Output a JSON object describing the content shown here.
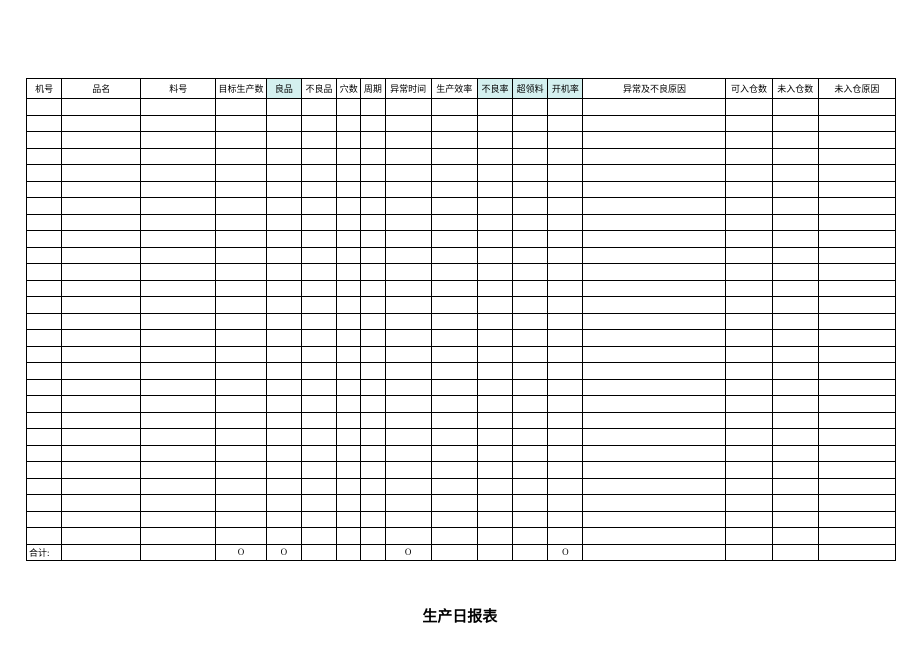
{
  "headers": {
    "machine_no": "机号",
    "product_name": "品名",
    "material_no": "料号",
    "target_qty": "目标生产数",
    "good": "良品",
    "defect": "不良品",
    "cavity": "穴数",
    "cycle": "周期",
    "abnormal_time": "异常时间",
    "efficiency": "生产效率",
    "defect_rate": "不良率",
    "over_material": "超领料",
    "open_rate": "开机率",
    "abnormal_reason": "异常及不良原因",
    "can_stock": "可入仓数",
    "not_stock": "未入仓数",
    "not_stock_reason": "未入仓原因"
  },
  "totals": {
    "label": "合计:",
    "target_qty": "O",
    "good": "O",
    "abnormal_time": "O",
    "open_rate": "O"
  },
  "empty_rows": 27,
  "title": "生产日报表",
  "chart_data": {
    "type": "table",
    "title": "生产日报表",
    "columns": [
      "机号",
      "品名",
      "料号",
      "目标生产数",
      "良品",
      "不良品",
      "穴数",
      "周期",
      "异常时间",
      "生产效率",
      "不良率",
      "超领料",
      "开机率",
      "异常及不良原因",
      "可入仓数",
      "未入仓数",
      "未入仓原因"
    ],
    "highlighted_columns": [
      "良品",
      "不良率",
      "超领料",
      "开机率"
    ],
    "data_rows": [],
    "totals_row": {
      "label": "合计:",
      "目标生产数": "O",
      "良品": "O",
      "异常时间": "O",
      "开机率": "O"
    }
  }
}
